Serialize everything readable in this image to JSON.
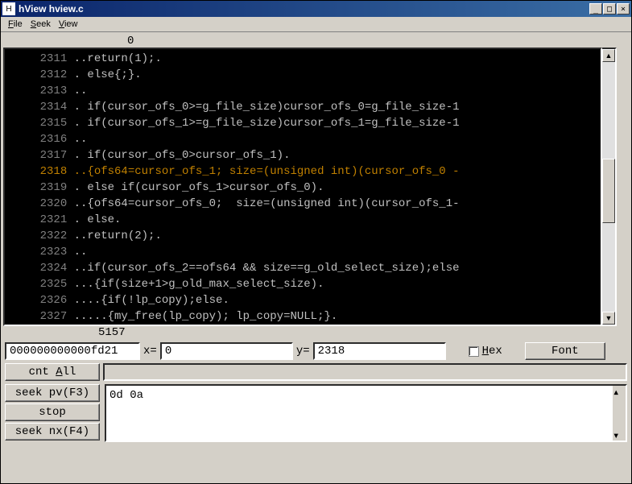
{
  "window": {
    "title": "hView hview.c",
    "icon_letter": "H"
  },
  "menu": {
    "file": "File",
    "seek": "Seek",
    "view": "View"
  },
  "viewer": {
    "col_header": "0",
    "total_lines": "5157",
    "lines": [
      {
        "num": "2311",
        "text": "..return(1);."
      },
      {
        "num": "2312",
        "text": ". else{;}."
      },
      {
        "num": "2313",
        "text": ".."
      },
      {
        "num": "2314",
        "text": ". if(cursor_ofs_0>=g_file_size)cursor_ofs_0=g_file_size-1"
      },
      {
        "num": "2315",
        "text": ". if(cursor_ofs_1>=g_file_size)cursor_ofs_1=g_file_size-1"
      },
      {
        "num": "2316",
        "text": ".."
      },
      {
        "num": "2317",
        "text": ". if(cursor_ofs_0>cursor_ofs_1)."
      },
      {
        "num": "2318",
        "text": "..{ofs64=cursor_ofs_1; size=(unsigned int)(cursor_ofs_0 -",
        "hl": true
      },
      {
        "num": "2319",
        "text": ". else if(cursor_ofs_1>cursor_ofs_0)."
      },
      {
        "num": "2320",
        "text": "..{ofs64=cursor_ofs_0;  size=(unsigned int)(cursor_ofs_1-"
      },
      {
        "num": "2321",
        "text": ". else."
      },
      {
        "num": "2322",
        "text": "..return(2);."
      },
      {
        "num": "2323",
        "text": ".."
      },
      {
        "num": "2324",
        "text": "..if(cursor_ofs_2==ofs64 && size==g_old_select_size);else"
      },
      {
        "num": "2325",
        "text": "...{if(size+1>g_old_max_select_size)."
      },
      {
        "num": "2326",
        "text": "....{if(!lp_copy);else."
      },
      {
        "num": "2327",
        "text": ".....{my_free(lp_copy); lp_copy=NULL;}."
      }
    ]
  },
  "controls": {
    "offset": "000000000000fd21",
    "x_label": "x=",
    "x_value": "0",
    "y_label": "y=",
    "y_value": "2318",
    "hex_label": "Hex",
    "font_btn": "Font",
    "cnt_all_btn": "cnt All",
    "seek_pv_btn": "seek pv(F3)",
    "stop_btn": "stop",
    "seek_nx_btn": "seek nx(F4)",
    "hex_area": "0d 0a"
  }
}
